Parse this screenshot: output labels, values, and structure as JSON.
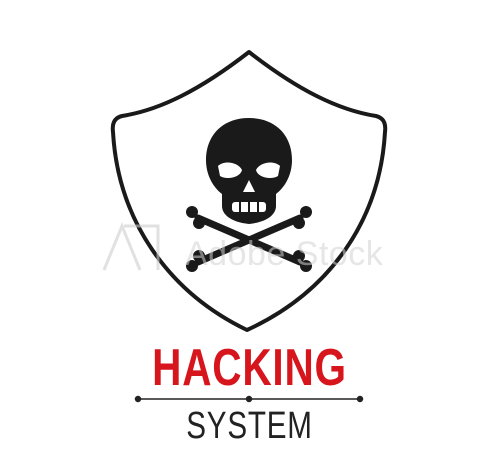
{
  "headline": {
    "title": "HACKING",
    "subtitle": "SYSTEM"
  },
  "watermark": {
    "text": "Adobe Stock"
  },
  "colors": {
    "title": "#d7151c",
    "subtitle": "#222222",
    "outline": "#1a1a1a",
    "icon": "#1a1a1a",
    "background": "#ffffff"
  },
  "icons": [
    "shield-icon",
    "skull-icon",
    "crossbones-icon",
    "adobe-logo-icon"
  ]
}
